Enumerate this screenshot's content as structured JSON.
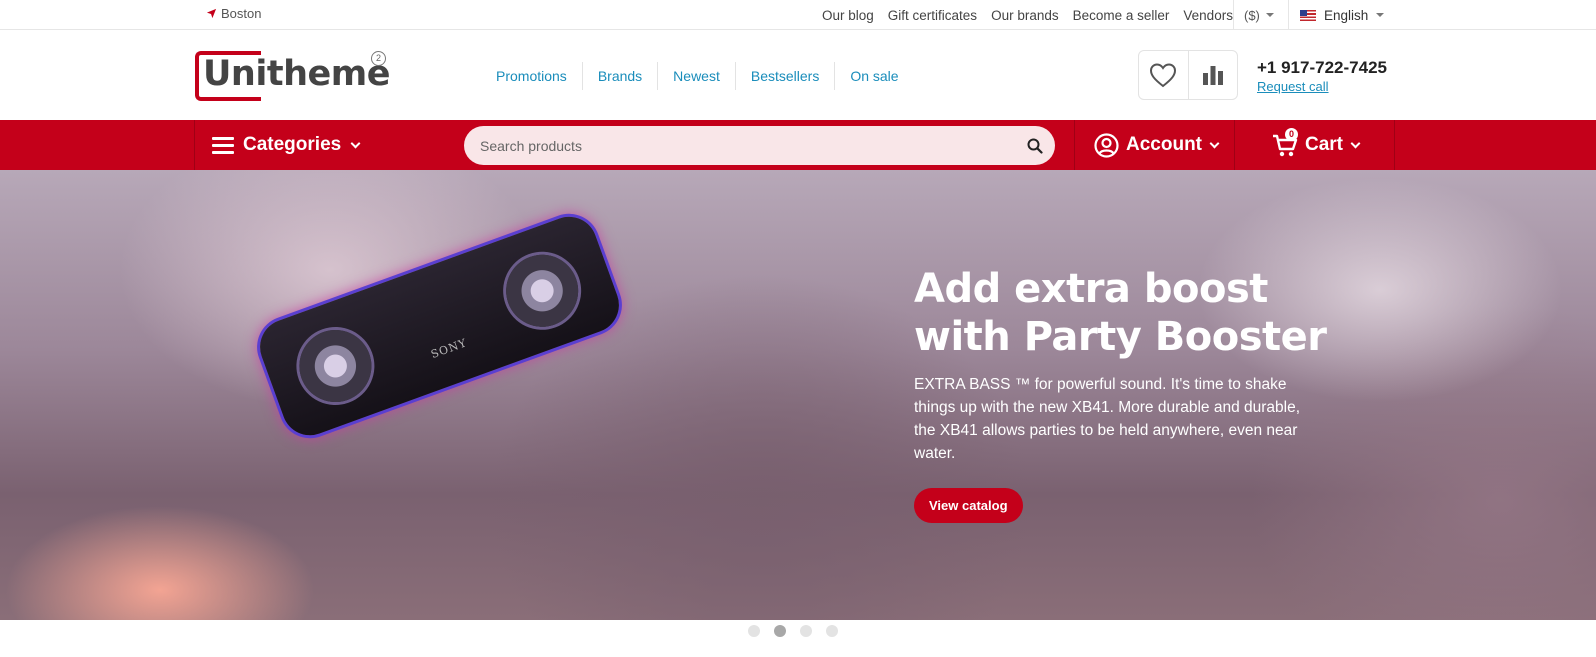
{
  "topbar": {
    "location": "Boston",
    "links": [
      "Our blog",
      "Gift certificates",
      "Our brands",
      "Become a seller",
      "Vendors"
    ],
    "currency": "($)",
    "language": "English"
  },
  "header": {
    "logo_text": "Unitheme",
    "logo_badge": "2",
    "nav": [
      "Promotions",
      "Brands",
      "Newest",
      "Bestsellers",
      "On sale"
    ],
    "phone": "+1 917-722-7425",
    "request_call": "Request call"
  },
  "menu": {
    "categories_label": "Categories",
    "search_placeholder": "Search products",
    "account_label": "Account",
    "cart_label": "Cart",
    "cart_count": "0"
  },
  "hero": {
    "title": "Add extra boost with Party Booster",
    "description": "EXTRA BASS ™ for powerful sound. It's time to shake things up with the new XB41. More durable and durable, the XB41 allows parties to be held anywhere, even near water.",
    "button_label": "View catalog",
    "speaker_brand": "SONY",
    "slides_total": 4,
    "active_slide": 2
  },
  "colors": {
    "brand_red": "#c4001a",
    "link_blue": "#1a8dbb",
    "search_bg": "#f9e6e8"
  },
  "icons": [
    "location-arrow-icon",
    "us-flag-icon",
    "heart-icon",
    "compare-chart-icon",
    "menu-icon",
    "search-icon",
    "user-circle-icon",
    "cart-icon"
  ]
}
